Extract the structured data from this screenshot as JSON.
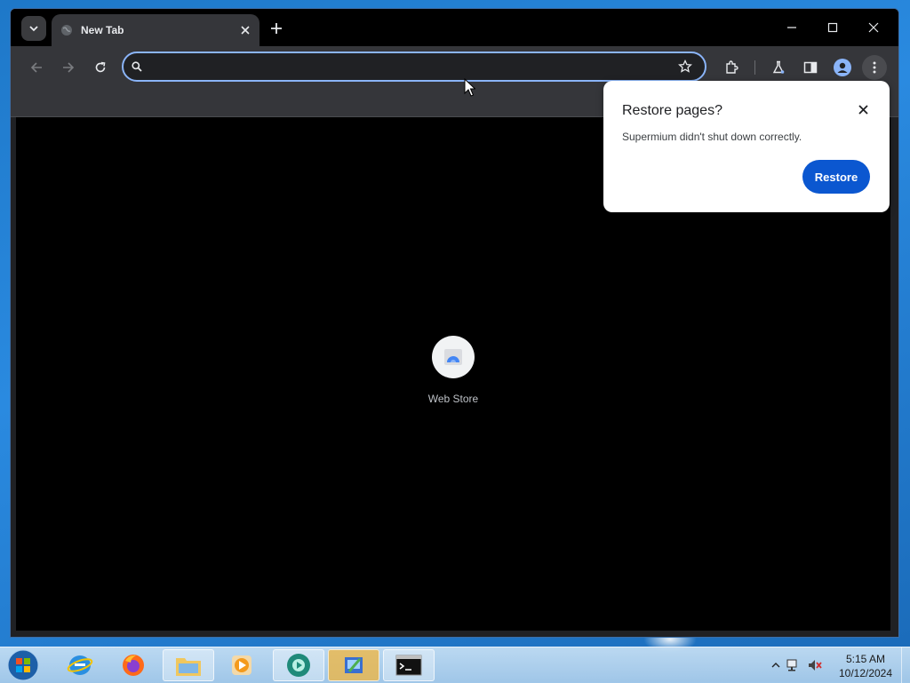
{
  "browser": {
    "tab": {
      "title": "New Tab"
    },
    "omnibox": {
      "value": "",
      "placeholder": ""
    },
    "window_controls": {
      "minimize": "minimize",
      "maximize": "maximize",
      "close": "close"
    }
  },
  "page": {
    "shortcuts": [
      {
        "label": "Web Store"
      }
    ]
  },
  "restore_bubble": {
    "title": "Restore pages?",
    "message": "Supermium didn't shut down correctly.",
    "restore_label": "Restore"
  },
  "taskbar": {
    "time": "5:15 AM",
    "date": "10/12/2024"
  },
  "colors": {
    "accent": "#0b57d0",
    "omnibox_focus": "#8ab4f8",
    "toolbar": "#35363a",
    "titlebar": "#000000"
  }
}
